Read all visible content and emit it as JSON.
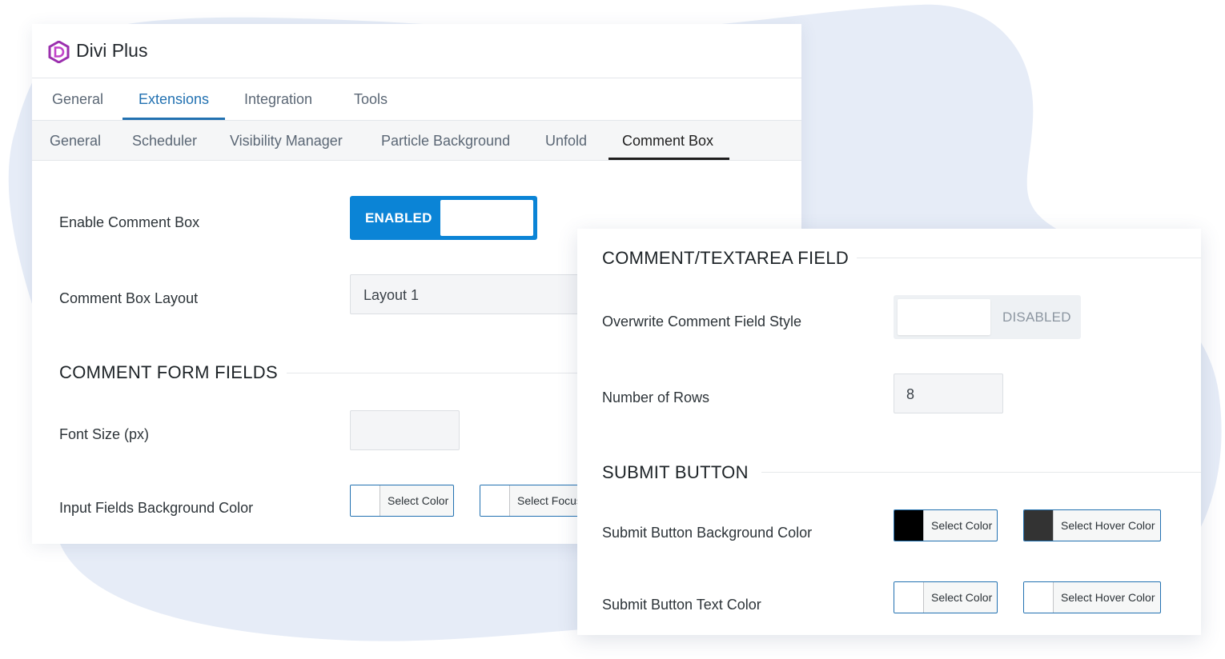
{
  "brand": {
    "name": "Divi Plus",
    "logo_icon": "divi-plus-logo-icon",
    "accent": "#9b2fae"
  },
  "tabs_primary": [
    {
      "label": "General",
      "active": false
    },
    {
      "label": "Extensions",
      "active": true
    },
    {
      "label": "Integration",
      "active": false
    },
    {
      "label": "Tools",
      "active": false
    }
  ],
  "tabs_secondary": [
    {
      "label": "General",
      "active": false
    },
    {
      "label": "Scheduler",
      "active": false
    },
    {
      "label": "Visibility Manager",
      "active": false
    },
    {
      "label": "Particle Background",
      "active": false
    },
    {
      "label": "Unfold",
      "active": false
    },
    {
      "label": "Comment Box",
      "active": true
    }
  ],
  "main": {
    "enable_label": "Enable Comment Box",
    "enable_toggle": {
      "text": "ENABLED",
      "state": "on",
      "color": "#0b84d6"
    },
    "layout_label": "Comment Box Layout",
    "layout_value": "Layout 1",
    "section_form_fields": "COMMENT FORM FIELDS",
    "font_size_label": "Font Size (px)",
    "font_size_value": "",
    "input_bg_label": "Input Fields Background Color",
    "input_bg_select": "Select Color",
    "input_bg_focus_select": "Select Focus"
  },
  "overlay": {
    "section_textarea": "COMMENT/TEXTAREA FIELD",
    "overwrite_label": "Overwrite Comment Field Style",
    "overwrite_toggle": {
      "text": "DISABLED",
      "state": "off"
    },
    "rows_label": "Number of Rows",
    "rows_value": "8",
    "section_submit": "SUBMIT BUTTON",
    "submit_bg_label": "Submit Button Background Color",
    "submit_bg_select": "Select Color",
    "submit_bg_swatch": "#000000",
    "submit_bg_hover_select": "Select Hover Color",
    "submit_bg_hover_swatch": "#333333",
    "submit_text_label": "Submit Button Text Color",
    "submit_text_select": "Select Color",
    "submit_text_swatch": "#ffffff",
    "submit_text_hover_select": "Select Hover Color",
    "submit_text_hover_swatch": "#ffffff"
  }
}
